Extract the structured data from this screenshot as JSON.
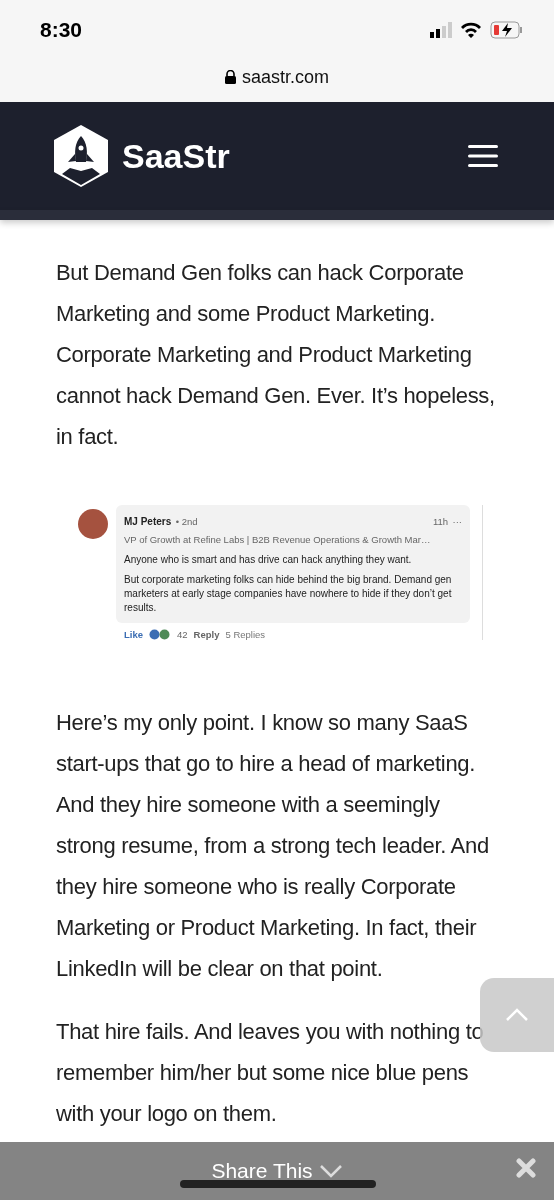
{
  "status_bar": {
    "time": "8:30"
  },
  "browser": {
    "url": "saastr.com"
  },
  "site_header": {
    "logo_text": "SaaStr"
  },
  "article": {
    "paragraphs_before": [
      "But Demand Gen folks can hack Corporate Marketing and some Product Marketing.  Corporate Marketing and Product Marketing cannot hack Demand Gen.  Ever.  It’s hopeless, in fact."
    ],
    "comment": {
      "author": "MJ Peters",
      "degree": "• 2nd",
      "headline": "VP of Growth at Refine Labs | B2B Revenue Operations & Growth Mar…",
      "time": "11h",
      "more": "···",
      "paragraphs": [
        "Anyone who is smart and has drive can hack anything they want.",
        "But corporate marketing folks can hide behind the big brand. Demand gen marketers at early stage companies have nowhere to hide if they don’t get results."
      ],
      "like": "Like",
      "reaction_count": "42",
      "reply": "Reply",
      "replies": "5 Replies"
    },
    "paragraphs_after": [
      "Here’s my only point.  I know so many SaaS start-ups that go to hire a head of marketing.  And they hire someone with a seemingly strong resume, from a strong tech leader.  And they hire someone who is really Corporate Marketing or Product Marketing.  In fact, their LinkedIn will be clear on that point.",
      "That hire fails.  And leaves you with nothing to remember him/her but some nice blue pens with your logo on them."
    ]
  },
  "share_bar": {
    "label": "Share This"
  }
}
